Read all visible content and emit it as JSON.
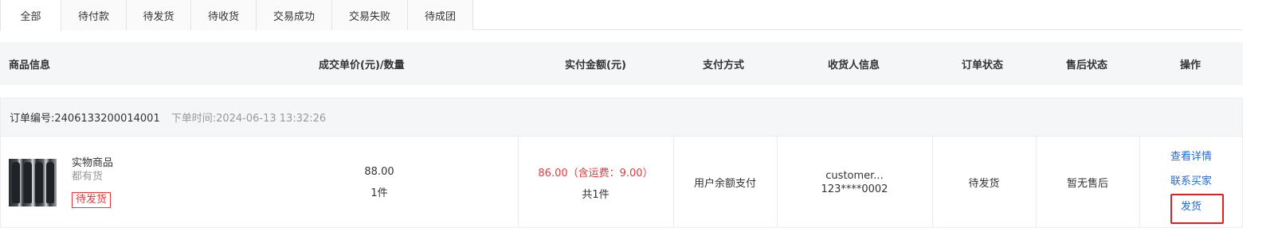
{
  "tabs": [
    {
      "label": "全部",
      "active": true
    },
    {
      "label": "待付款",
      "active": false
    },
    {
      "label": "待发货",
      "active": false
    },
    {
      "label": "待收货",
      "active": false
    },
    {
      "label": "交易成功",
      "active": false
    },
    {
      "label": "交易失败",
      "active": false
    },
    {
      "label": "待成团",
      "active": false
    }
  ],
  "columns": {
    "product": "商品信息",
    "price_qty": "成交单价(元)/数量",
    "paid": "实付金额(元)",
    "payment": "支付方式",
    "receiver": "收货人信息",
    "status": "订单状态",
    "aftersale": "售后状态",
    "actions": "操作"
  },
  "order": {
    "number": "订单编号:2406133200014001",
    "time": "下单时间:2024-06-13 13:32:26",
    "product_name": "实物商品",
    "stock": "都有货",
    "badge": "待发货",
    "unit_price": "88.00",
    "quantity": "1件",
    "paid_amount": "86.00（含运费：9.00）",
    "total_qty": "共1件",
    "payment_method": "用户余额支付",
    "receiver_name": "customer...",
    "receiver_phone": "123****0002",
    "status": "待发货",
    "aftersale": "暂无售后",
    "actions": {
      "detail": "查看详情",
      "contact": "联系买家",
      "ship": "发货"
    }
  },
  "colors": {
    "accent_red": "#e4393c",
    "link_blue": "#2468d8",
    "highlight_box": "#e02020",
    "header_bg": "#f5f6f7"
  }
}
